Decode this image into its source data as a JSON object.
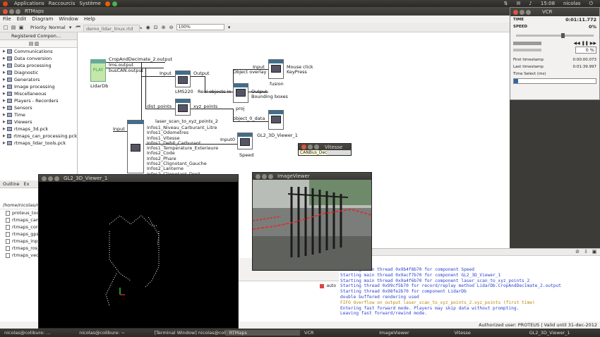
{
  "topbar": {
    "applications": "Applications",
    "places": "Raccourcis",
    "system": "Système",
    "clock": "15:08",
    "user": "nicolas"
  },
  "rtmaps": {
    "title": "RTMaps",
    "menu": [
      "File",
      "Edit",
      "Diagram",
      "Window",
      "Help"
    ],
    "priority_label": "Priority",
    "priority_value": "Normal",
    "zoom": "100%",
    "components_tab": "Registered Compon...",
    "diagram_tab": "demo_lidar_linux.rtd",
    "tree": [
      "Communications",
      "Data conversion",
      "Data processing",
      "Diagnostic",
      "Generators",
      "Image processing",
      "Miscellaneous",
      "Players - Recorders",
      "Sensors",
      "Time",
      "Viewers",
      "rtmaps_3d.pck",
      "rtmaps_can_processing.pck",
      "rtmaps_lidar_tools.pck"
    ],
    "outline_tab": "Outline",
    "explorer_tab": "Ex",
    "path": "/home/nicolas/r",
    "files": [
      "proteus_too",
      "rtmaps_cam",
      "rtmaps_core",
      "rtmaps_gps",
      "rtmaps_inpu",
      "rtmaps_ros_",
      "rtmaps_vect"
    ],
    "console": [
      {
        "text": "Starting main thread 0x9b4f8b70 for component Speed",
        "color": "#2a3fd0"
      },
      {
        "text": "Starting main thread 0x9acf7b70 for component GL2_3D_Viewer_1",
        "color": "#2a3fd0"
      },
      {
        "text": "Starting main thread 0x9a4f6b70 for component laser_scan_to_xyz_points_2",
        "color": "#2a3fd0"
      },
      {
        "text": "Starting thread 0x99cf5b70 for record/replay method LidarDb.CropAndDecimate_2.output",
        "color": "#2a3fd0"
      },
      {
        "text": "Starting thread 0x98fe2b70 for component LidarDb",
        "color": "#2a3fd0"
      },
      {
        "text": "double buffered rendering used",
        "color": "#2a3fd0"
      },
      {
        "text": "FIFO Overflow on output laser_scan_to_xyz_points_2.xyz_points (first time)",
        "color": "#b8860b"
      },
      {
        "text": "Entering fast forward mode. Players may skip data without prompting.",
        "color": "#2a3fd0"
      },
      {
        "text": "Leaving fast forward/rewind mode.",
        "color": "#2a3fd0"
      }
    ],
    "status": "Authorized user: PROTEUS | Valid until 31-dec-2012",
    "auto_label": "auto"
  },
  "diagram": {
    "player": "PLAY",
    "player_name": "LidarDb",
    "out1": "CropAndDecimate_2.output",
    "out2": "lms.output",
    "out3": "busCAN.output",
    "lms_in": "Input",
    "lms_out": "Output",
    "lms_name": "LMS220",
    "proj_in": "Real objects in",
    "proj_out": "Output",
    "proj_out2": "Bounding boxes",
    "proj_name": "proj",
    "fusion_in1": "Input",
    "fusion_in2": "Object overlay",
    "fusion_in3": "Mouse click",
    "fusion_in4": "KeyPress",
    "fusion_name": "fusion",
    "xyz_in": "dist_points",
    "xyz_out": "xyz_points",
    "xyz_name": "laser_scan_to_xyz_points_2",
    "gl_in": "object_0_data",
    "gl_name": "GL2_3D_Viewer_1",
    "can_in": "Input",
    "can_outputs": [
      "Infos1_Niveau_Carburant_Litre",
      "Infos1_Odometres",
      "Infos1_Vitesse",
      "Infos1_Debit_Carburant",
      "Infos1_Temperature_Exterieure",
      "Infos2_Code",
      "Infos2_Phare",
      "Infos2_Clignotant_Gauche",
      "Infos2_Lanterne",
      "Infos2_Clignotant_Droit"
    ],
    "speed_in": "Input0",
    "speed_name": "Speed"
  },
  "vcr": {
    "title": "VCR",
    "time_label": "TIME",
    "time_value": "0:01:11.772",
    "speed_label": "SPEED",
    "speed_value": "0%",
    "speed_box": "0 %",
    "first_ts_label": "First timestamp",
    "first_ts": "0:00:00.073",
    "last_ts_label": "Last timestamp",
    "last_ts": "0:01:39.997",
    "time_select_label": "Time Select (ms)"
  },
  "windows": {
    "gl2_title": "GL2_3D_Viewer_1",
    "image_title": "ImageViewer",
    "vitesse_title": "Vitesse",
    "vitesse_value": "CANBus_Dec"
  },
  "taskbar": [
    "nicolas@colibure: ...",
    "nicolas@colibure: ~",
    "[Terminal Window] nicolas@colibure: ~",
    "RTMaps",
    "VCR",
    "ImageViewer",
    "Vitesse",
    "GL2_3D_Viewer_1"
  ]
}
